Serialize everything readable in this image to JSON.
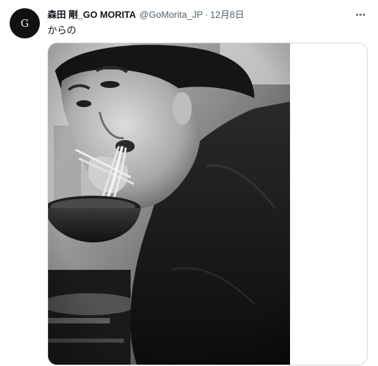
{
  "tweet": {
    "avatar_letter": "G",
    "display_name": "森田 剛_GO MORITA",
    "handle": "@GoMorita_JP",
    "separator": "·",
    "date": "12月8日",
    "text": "からの",
    "more_icon": "more-horizontal-icon"
  },
  "media": {
    "alt": "Monochrome photo of a man eating noodles"
  },
  "colors": {
    "name": "#0f1419",
    "secondary": "#536471",
    "border": "#cfd9de"
  }
}
